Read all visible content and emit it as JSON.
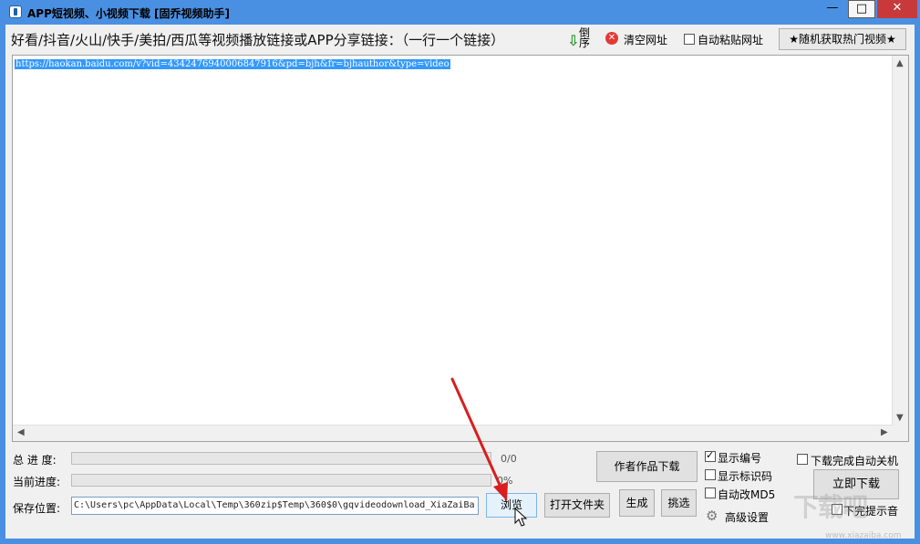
{
  "window": {
    "title": "APP短视频、小视频下载 [固乔视频助手]",
    "controls": {
      "minimize": "—",
      "maximize": "□",
      "close": "✕"
    }
  },
  "toolbar": {
    "prompt": "好看/抖音/火山/快手/美拍/西瓜等视频播放链接或APP分享链接：（一行一个链接）",
    "sort_label": "倒序",
    "clear_label": "清空网址",
    "auto_paste_label": "自动粘贴网址",
    "auto_paste_checked": false,
    "hot_button": "★随机获取热门视频★"
  },
  "editor": {
    "content": "https://haokan.baidu.com/v?vid=4342476940006847916&pd=bjh&fr=bjhauthor&type=video"
  },
  "bottom": {
    "total_progress_label": "总 进 度:",
    "total_progress_value": "0/0",
    "current_progress_label": "当前进度:",
    "current_progress_value": "0%",
    "save_location_label": "保存位置:",
    "save_path": "C:\\Users\\pc\\AppData\\Local\\Temp\\360zip$Temp\\360$0\\gqvideodownload_XiaZaiBa",
    "browse_button": "浏览",
    "open_folder_button": "打开文件夹",
    "author_download_button": "作者作品下载",
    "generate_button": "生成",
    "select_button": "挑选",
    "show_number_label": "显示编号",
    "show_number_checked": true,
    "show_watermark_label": "显示标识码",
    "show_watermark_checked": false,
    "auto_md5_label": "自动改MD5",
    "auto_md5_checked": false,
    "advanced_label": "高级设置",
    "shutdown_label": "下载完成自动关机",
    "shutdown_checked": false,
    "download_now_button": "立即下载",
    "completion_sound_label": "下完提示音",
    "completion_sound_checked": false
  },
  "watermark": {
    "text": "下载吧",
    "site": "www.xiazaiba.com"
  }
}
